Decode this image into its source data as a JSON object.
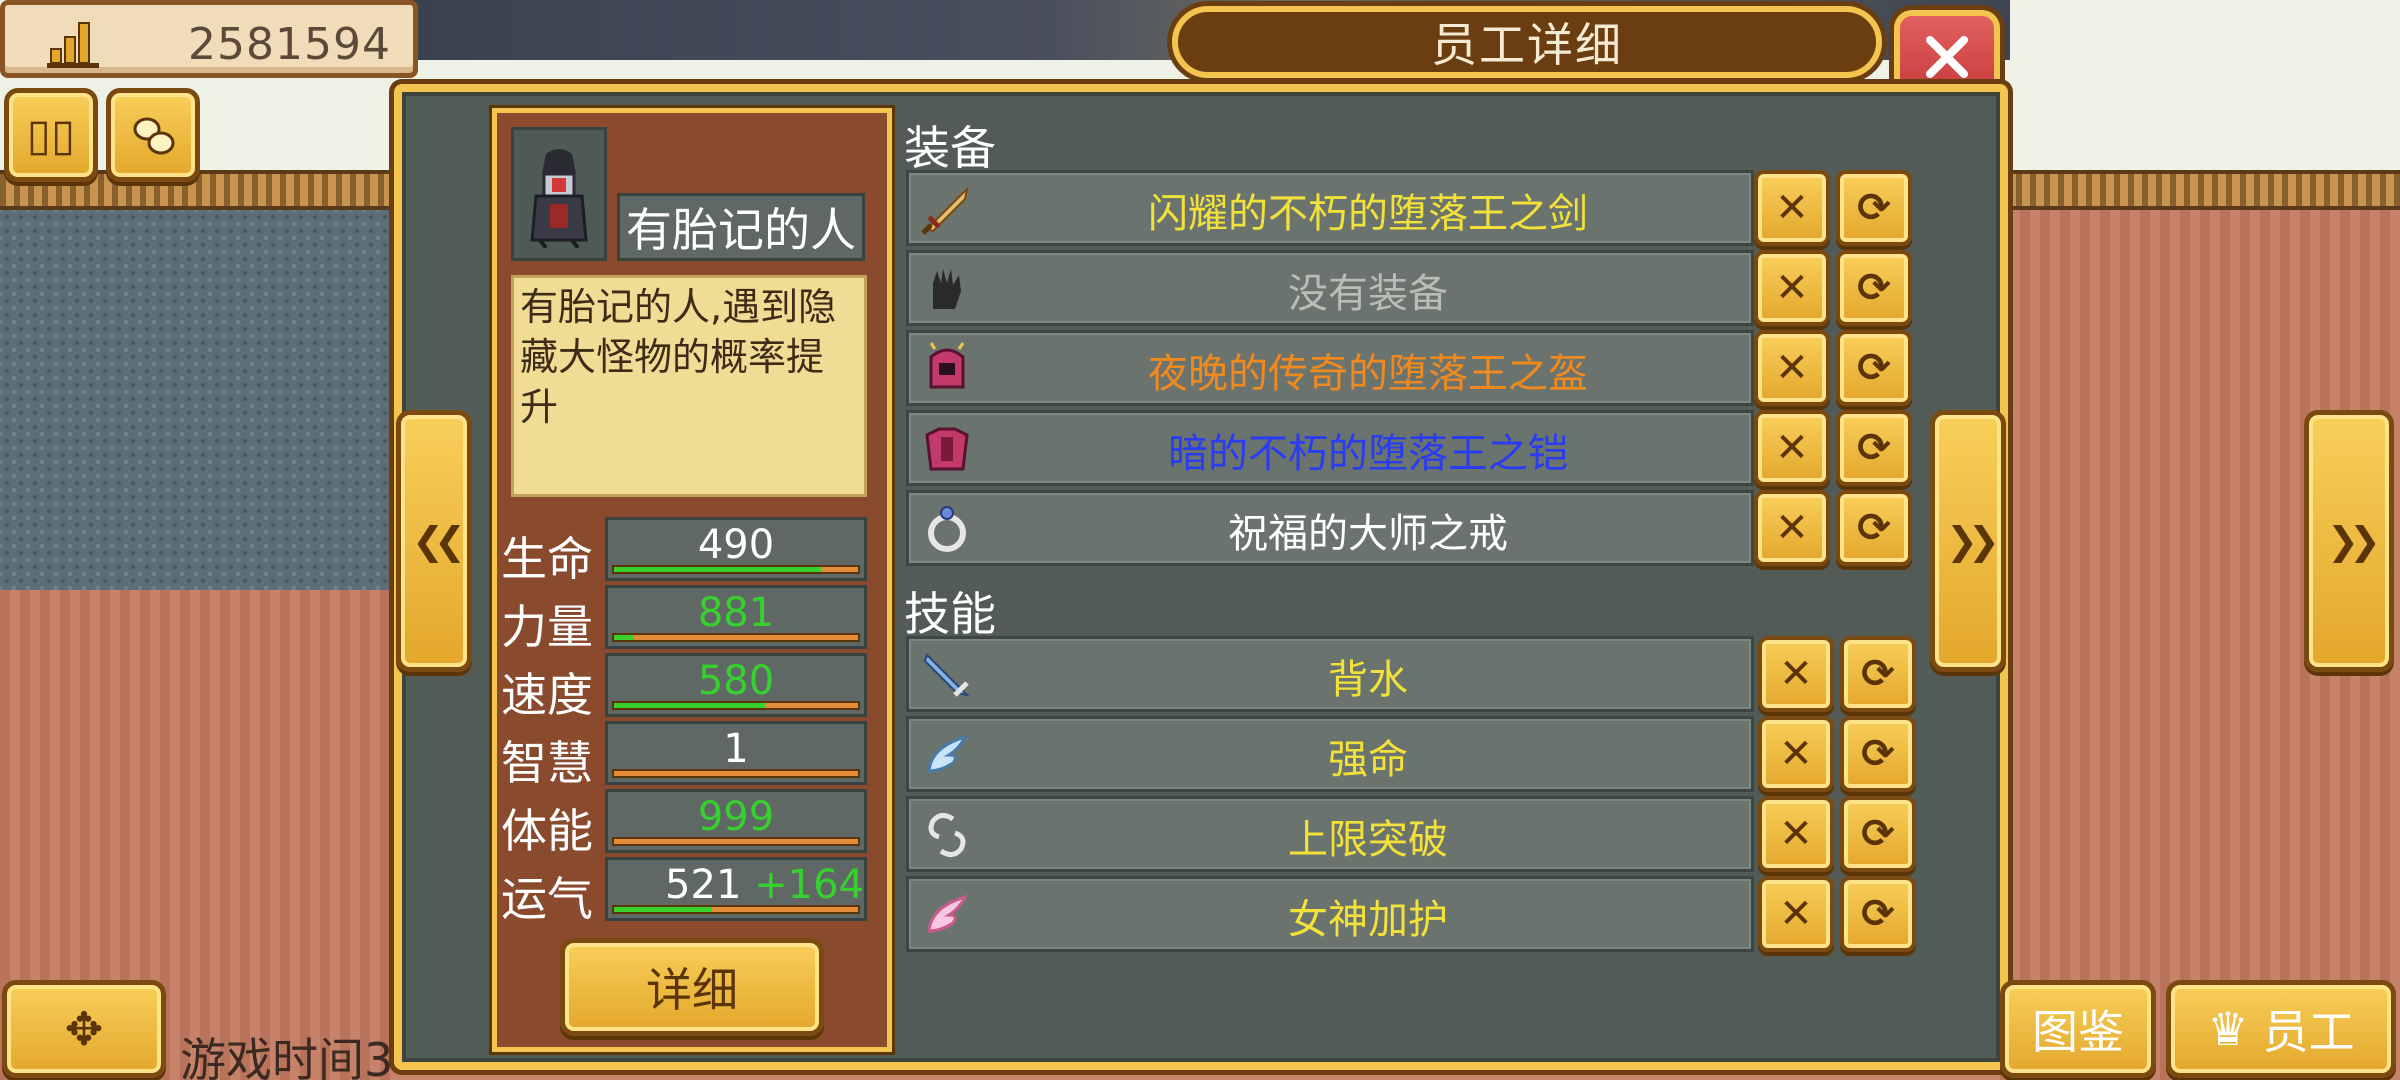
{
  "hud": {
    "money_icon": "building-chart-icon",
    "money": "2581594",
    "pause_icon": "pause-icon",
    "resources_icon": "ore-icon",
    "game_time": "游戏时间3"
  },
  "dialog": {
    "title": "员工详细",
    "close_icon": "close-icon"
  },
  "character": {
    "name": "有胎记的人",
    "description": "有胎记的人,遇到隐藏大怪物的概率提升",
    "stats": [
      {
        "label": "生命",
        "value": "490",
        "bonus": "",
        "color": "#ffffff",
        "fill": 0.85
      },
      {
        "label": "力量",
        "value": "881",
        "bonus": "",
        "color": "#36d12f",
        "fill": 0.08
      },
      {
        "label": "速度",
        "value": "580",
        "bonus": "",
        "color": "#36d12f",
        "fill": 0.62
      },
      {
        "label": "智慧",
        "value": "1",
        "bonus": "",
        "color": "#ffffff",
        "fill": 0.0
      },
      {
        "label": "体能",
        "value": "999",
        "bonus": "",
        "color": "#36d12f",
        "fill": 0.0
      },
      {
        "label": "运气",
        "value": "521",
        "bonus": "+164",
        "color": "#ffffff",
        "fill": 0.4
      }
    ],
    "detail_label": "详细"
  },
  "equipment": {
    "title": "装备",
    "items": [
      {
        "name": "闪耀的不朽的堕落王之剑",
        "color": "#f2e13a",
        "icon": "sword-icon"
      },
      {
        "name": "没有装备",
        "color": "#b9bdb8",
        "icon": "glove-icon"
      },
      {
        "name": "夜晚的传奇的堕落王之盔",
        "color": "#f08a1e",
        "icon": "helmet-icon"
      },
      {
        "name": "暗的不朽的堕落王之铠",
        "color": "#2a3cf0",
        "icon": "armor-icon"
      },
      {
        "name": "祝福的大师之戒",
        "color": "#ffffff",
        "icon": "ring-icon"
      }
    ]
  },
  "skills": {
    "title": "技能",
    "items": [
      {
        "name": "背水",
        "color": "#f2e13a",
        "icon": "blade-icon"
      },
      {
        "name": "强命",
        "color": "#f2e13a",
        "icon": "wing-icon"
      },
      {
        "name": "上限突破",
        "color": "#f2e13a",
        "icon": "chain-icon"
      },
      {
        "name": "女神加护",
        "color": "#f2e13a",
        "icon": "pink-wing-icon"
      }
    ]
  },
  "bottom": {
    "map_icon": "compass-icon",
    "codex_label": "图鉴",
    "staff_label": "员工",
    "staff_icon": "crown-icon"
  }
}
